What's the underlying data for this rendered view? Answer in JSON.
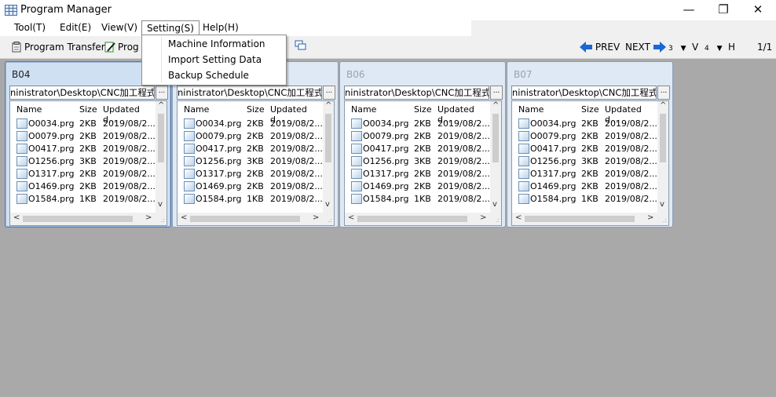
{
  "window": {
    "title": "Program Manager",
    "controls": [
      "minimize",
      "restore",
      "close"
    ]
  },
  "menu": {
    "items": [
      {
        "label": "Tool(T)"
      },
      {
        "label": "Edit(E)"
      },
      {
        "label": "View(V)"
      },
      {
        "label": "Setting(S)"
      },
      {
        "label": "Help(H)"
      }
    ],
    "open_menu": "Setting(S)",
    "dropdown": [
      "Machine Information",
      "Import Setting Data",
      "Backup Schedule"
    ]
  },
  "toolbar": {
    "program_transfer": "Program Transfer",
    "prog_truncated": "Prog",
    "prev": "PREV",
    "next": "NEXT",
    "h_count": "3",
    "v_label": "V",
    "v_count": "4",
    "h_label": "H",
    "page": "1/1"
  },
  "panels": [
    {
      "name": "B04",
      "active": true
    },
    {
      "name": "",
      "active": false
    },
    {
      "name": "B06",
      "active": false
    },
    {
      "name": "B07",
      "active": false
    }
  ],
  "panel_common": {
    "path": "ninistrator\\Desktop\\CNC加工程式",
    "browse": "...",
    "columns": [
      "Name",
      "Size",
      "Updated d..."
    ],
    "files": [
      {
        "name": "O0034.prg",
        "size": "2KB",
        "updated": "2019/08/2..."
      },
      {
        "name": "O0079.prg",
        "size": "2KB",
        "updated": "2019/08/2..."
      },
      {
        "name": "O0417.prg",
        "size": "2KB",
        "updated": "2019/08/2..."
      },
      {
        "name": "O1256.prg",
        "size": "3KB",
        "updated": "2019/08/2..."
      },
      {
        "name": "O1317.prg",
        "size": "2KB",
        "updated": "2019/08/2..."
      },
      {
        "name": "O1469.prg",
        "size": "2KB",
        "updated": "2019/08/2..."
      },
      {
        "name": "O1584.prg",
        "size": "1KB",
        "updated": "2019/08/2..."
      }
    ]
  },
  "colors": {
    "workspace": "#a9a9a9",
    "active_panel": "#cfe0f3",
    "nav_arrow": "#1a67d6"
  }
}
